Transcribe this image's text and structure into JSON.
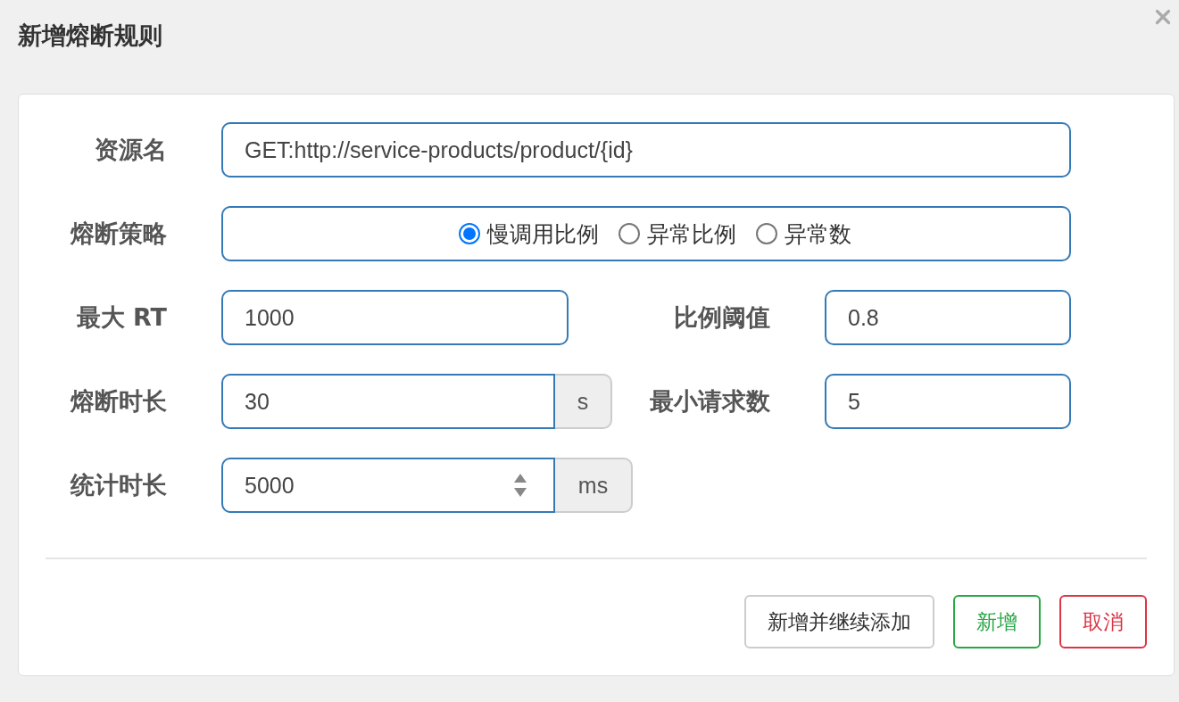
{
  "dialog": {
    "title": "新增熔断规则"
  },
  "form": {
    "resource": {
      "label": "资源名",
      "value": "GET:http://service-products/product/{id}"
    },
    "strategy": {
      "label": "熔断策略",
      "options": [
        {
          "label": "慢调用比例",
          "selected": true
        },
        {
          "label": "异常比例",
          "selected": false
        },
        {
          "label": "异常数",
          "selected": false
        }
      ]
    },
    "max_rt": {
      "label": "最大 RT",
      "value": "1000"
    },
    "ratio": {
      "label": "比例阈值",
      "value": "0.8"
    },
    "break_time": {
      "label": "熔断时长",
      "value": "30",
      "unit": "s"
    },
    "min_requests": {
      "label": "最小请求数",
      "value": "5"
    },
    "stat_time": {
      "label": "统计时长",
      "value": "5000",
      "unit": "ms"
    }
  },
  "buttons": [
    {
      "label": "新增并继续添加",
      "kind": "default"
    },
    {
      "label": "新增",
      "kind": "success"
    },
    {
      "label": "取消",
      "kind": "danger"
    }
  ]
}
